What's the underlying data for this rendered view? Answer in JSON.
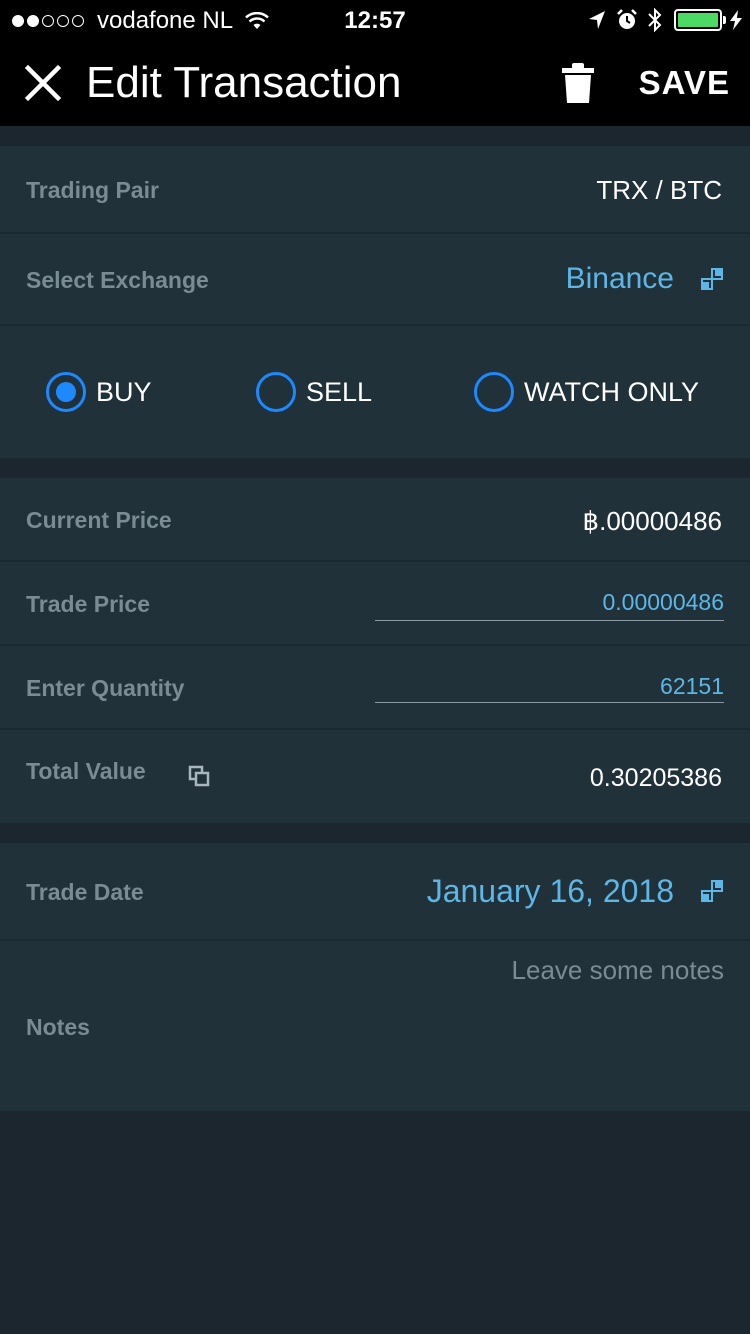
{
  "status_bar": {
    "carrier": "vodafone NL",
    "time": "12:57",
    "signal_bars_filled": 2,
    "signal_bars_total": 5
  },
  "nav": {
    "title": "Edit Transaction",
    "save_label": "SAVE"
  },
  "pair": {
    "label": "Trading Pair",
    "value": "TRX / BTC"
  },
  "exchange": {
    "label": "Select Exchange",
    "value": "Binance"
  },
  "trade_type": {
    "options": [
      {
        "label": "BUY",
        "selected": true
      },
      {
        "label": "SELL",
        "selected": false
      },
      {
        "label": "WATCH ONLY",
        "selected": false
      }
    ]
  },
  "prices": {
    "current_price_label": "Current Price",
    "current_price_value": "฿.00000486",
    "trade_price_label": "Trade Price",
    "trade_price_value": "0.00000486",
    "quantity_label": "Enter Quantity",
    "quantity_value": "62151",
    "total_label": "Total Value",
    "total_value": "0.30205386"
  },
  "date": {
    "label": "Trade Date",
    "value": "January 16, 2018"
  },
  "notes": {
    "label": "Notes",
    "placeholder": "Leave some notes"
  },
  "colors": {
    "accent_blue": "#5eb6e6",
    "radio_blue": "#1e88ff",
    "section_bg": "#203139",
    "page_bg": "#1b262f",
    "label_gray": "#7a8b93",
    "battery_green": "#4cd964"
  },
  "icons": {
    "close": "close-icon",
    "trash": "trash-icon",
    "expand": "expand-icon",
    "copy": "copy-icon",
    "wifi": "wifi-icon",
    "location": "location-arrow-icon",
    "alarm": "alarm-icon",
    "bluetooth": "bluetooth-icon",
    "charging": "charging-bolt-icon"
  }
}
